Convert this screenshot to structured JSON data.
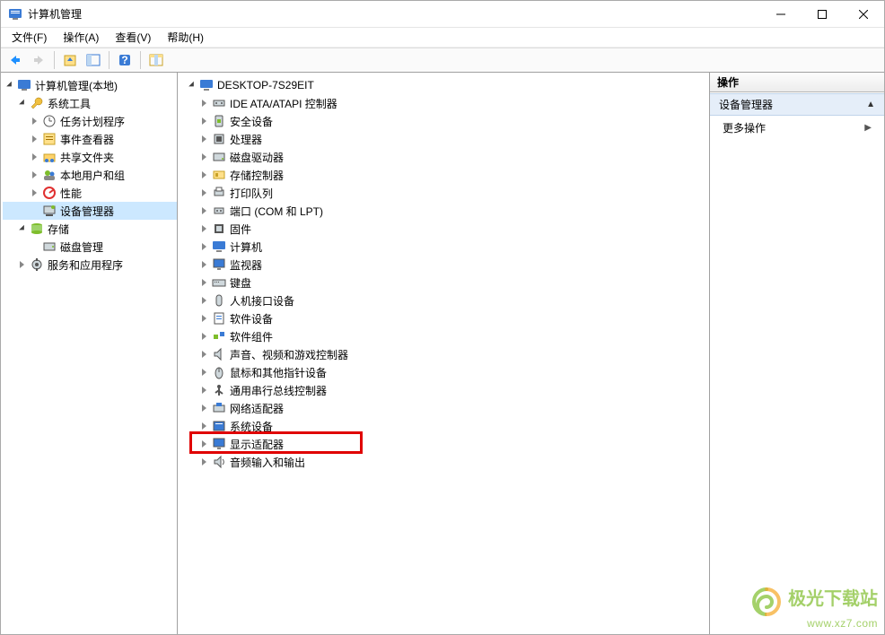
{
  "window": {
    "title": "计算机管理"
  },
  "menu": {
    "file": "文件(F)",
    "action": "操作(A)",
    "view": "查看(V)",
    "help": "帮助(H)"
  },
  "left_tree": {
    "root": "计算机管理(本地)",
    "system_tools": "系统工具",
    "task_scheduler": "任务计划程序",
    "event_viewer": "事件查看器",
    "shared_folders": "共享文件夹",
    "local_users": "本地用户和组",
    "performance": "性能",
    "device_manager": "设备管理器",
    "storage": "存储",
    "disk_management": "磁盘管理",
    "services_apps": "服务和应用程序"
  },
  "mid_tree": {
    "root": "DESKTOP-7S29EIT",
    "ide": "IDE ATA/ATAPI 控制器",
    "security": "安全设备",
    "cpu": "处理器",
    "disk_drives": "磁盘驱动器",
    "storage_ctrl": "存储控制器",
    "print_queue": "打印队列",
    "ports": "端口 (COM 和 LPT)",
    "firmware": "固件",
    "computer": "计算机",
    "monitor": "监视器",
    "keyboard": "键盘",
    "hid": "人机接口设备",
    "software_dev": "软件设备",
    "software_comp": "软件组件",
    "audio_game": "声音、视频和游戏控制器",
    "mouse": "鼠标和其他指针设备",
    "usb": "通用串行总线控制器",
    "network": "网络适配器",
    "system_dev": "系统设备",
    "display": "显示适配器",
    "audio_io": "音频输入和输出"
  },
  "actions": {
    "header": "操作",
    "section": "设备管理器",
    "more": "更多操作"
  },
  "watermark": {
    "line1": "极光下载站",
    "line2": "www.xz7.com"
  }
}
